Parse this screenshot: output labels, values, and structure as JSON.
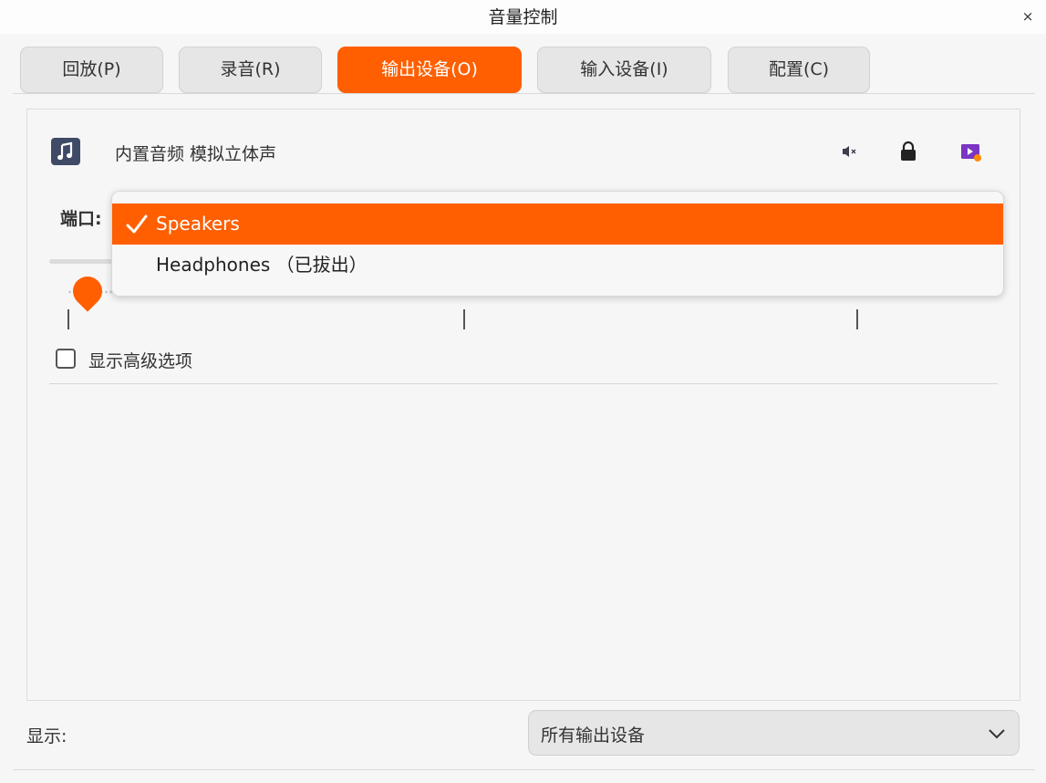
{
  "window": {
    "title": "音量控制"
  },
  "tabs": [
    {
      "label": "回放(P)",
      "active": false
    },
    {
      "label": "录音(R)",
      "active": false
    },
    {
      "label": "输出设备(O)",
      "active": true
    },
    {
      "label": "输入设备(I)",
      "active": false
    },
    {
      "label": "配置(C)",
      "active": false
    }
  ],
  "device": {
    "name": "内置音频 模拟立体声",
    "icon": "music-note-icon",
    "port_label": "端口:",
    "advanced_label": "显示高级选项",
    "advanced_checked": false,
    "volume_fraction": 0.05
  },
  "port_dropdown": {
    "options": [
      {
        "label": "Speakers",
        "selected": true
      },
      {
        "label": "Headphones （已拔出）",
        "selected": false
      }
    ]
  },
  "footer": {
    "show_label": "显示:",
    "show_value": "所有输出设备"
  },
  "colors": {
    "accent": "#ff5f00",
    "device_icon": "#3f4a66"
  }
}
